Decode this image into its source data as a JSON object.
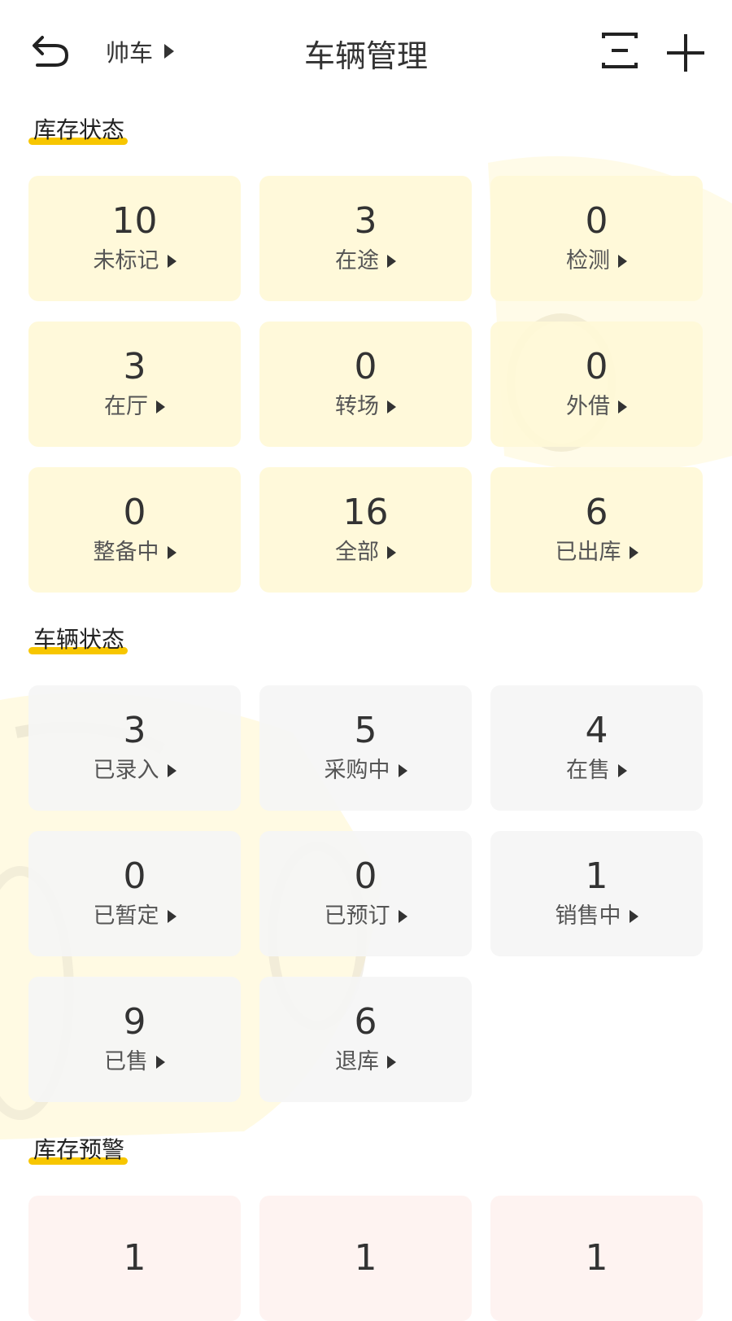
{
  "header": {
    "title": "车辆管理",
    "brand": "帅车",
    "icons": {
      "back": "back-arrow-icon",
      "filter": "filter-lines-icon",
      "add": "plus-icon"
    }
  },
  "colors": {
    "accent": "#f7c600",
    "inventory_card": "#fff9d7",
    "vehicle_card": "#f5f5f5",
    "warning_card": "#fef2f0"
  },
  "inventory": {
    "title": "库存状态",
    "items": [
      {
        "value": "10",
        "label": "未标记"
      },
      {
        "value": "3",
        "label": "在途"
      },
      {
        "value": "0",
        "label": "检测"
      },
      {
        "value": "3",
        "label": "在厅"
      },
      {
        "value": "0",
        "label": "转场"
      },
      {
        "value": "0",
        "label": "外借"
      },
      {
        "value": "0",
        "label": "整备中"
      },
      {
        "value": "16",
        "label": "全部"
      },
      {
        "value": "6",
        "label": "已出库"
      }
    ]
  },
  "vehicle": {
    "title": "车辆状态",
    "items": [
      {
        "value": "3",
        "label": "已录入"
      },
      {
        "value": "5",
        "label": "采购中"
      },
      {
        "value": "4",
        "label": "在售"
      },
      {
        "value": "0",
        "label": "已暂定"
      },
      {
        "value": "0",
        "label": "已预订"
      },
      {
        "value": "1",
        "label": "销售中"
      },
      {
        "value": "9",
        "label": "已售"
      },
      {
        "value": "6",
        "label": "退库"
      }
    ]
  },
  "warning": {
    "title": "库存预警",
    "items": [
      {
        "value": "1"
      },
      {
        "value": "1"
      },
      {
        "value": "1"
      }
    ]
  }
}
